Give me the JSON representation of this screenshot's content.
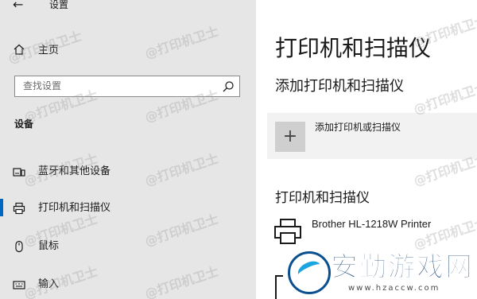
{
  "window": {
    "back": "←",
    "title": "设置"
  },
  "sidebar": {
    "home_label": "主页",
    "search_placeholder": "查找设置",
    "section": "设备",
    "items": [
      {
        "label": "蓝牙和其他设备",
        "icon": "bluetooth-devices-icon",
        "active": false
      },
      {
        "label": "打印机和扫描仪",
        "icon": "printer-icon",
        "active": true
      },
      {
        "label": "鼠标",
        "icon": "mouse-icon",
        "active": false
      },
      {
        "label": "输入",
        "icon": "keyboard-icon",
        "active": false
      }
    ]
  },
  "main": {
    "title": "打印机和扫描仪",
    "add_heading": "添加打印机和扫描仪",
    "add_button_symbol": "+",
    "add_button_label": "添加打印机或扫描仪",
    "list_heading": "打印机和扫描仪",
    "printers": [
      {
        "name": "Brother HL-1218W Printer"
      }
    ]
  },
  "watermark": "@打印机卫士",
  "brand": {
    "name": "安勤游戏网",
    "url": "www.hzaccw.com"
  },
  "colors": {
    "sidebar_bg": "#e6e6e6",
    "accent": "#0067c0",
    "add_row_bg": "#f2f2f2"
  }
}
